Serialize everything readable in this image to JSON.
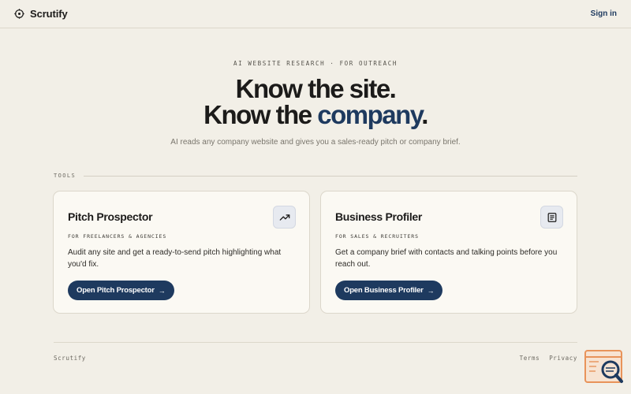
{
  "header": {
    "brand_name": "Scrutify",
    "brand_icon": "crosshair-icon",
    "signin_label": "Sign in"
  },
  "hero": {
    "eyebrow": "AI WEBSITE RESEARCH · FOR OUTREACH",
    "headline_line1": "Know the site.",
    "headline_line2_prefix": "Know the ",
    "headline_line2_accent": "company",
    "headline_line2_suffix": ".",
    "subtitle": "AI reads any company website and gives you a sales-ready pitch or company brief."
  },
  "tools": {
    "section_label": "TOOLS",
    "cards": [
      {
        "title": "Pitch Prospector",
        "icon": "trending-up-icon",
        "tag": "FOR FREELANCERS & AGENCIES",
        "description": "Audit any site and get a ready-to-send pitch highlighting what you'd fix.",
        "button_label": "Open Pitch Prospector",
        "button_arrow": "→"
      },
      {
        "title": "Business Profiler",
        "icon": "document-icon",
        "tag": "FOR SALES & RECRUITERS",
        "description": "Get a company brief with contacts and talking points before you reach out.",
        "button_label": "Open Business Profiler",
        "button_arrow": "→"
      }
    ]
  },
  "footer": {
    "brand": "Scrutify",
    "links": [
      "Terms",
      "Privacy"
    ]
  },
  "widget": {
    "icon": "browser-search-icon"
  },
  "colors": {
    "background": "#f2efe7",
    "accent": "#1e3a5f",
    "card_background": "#fbf9f3",
    "widget_orange": "#e8935a"
  }
}
